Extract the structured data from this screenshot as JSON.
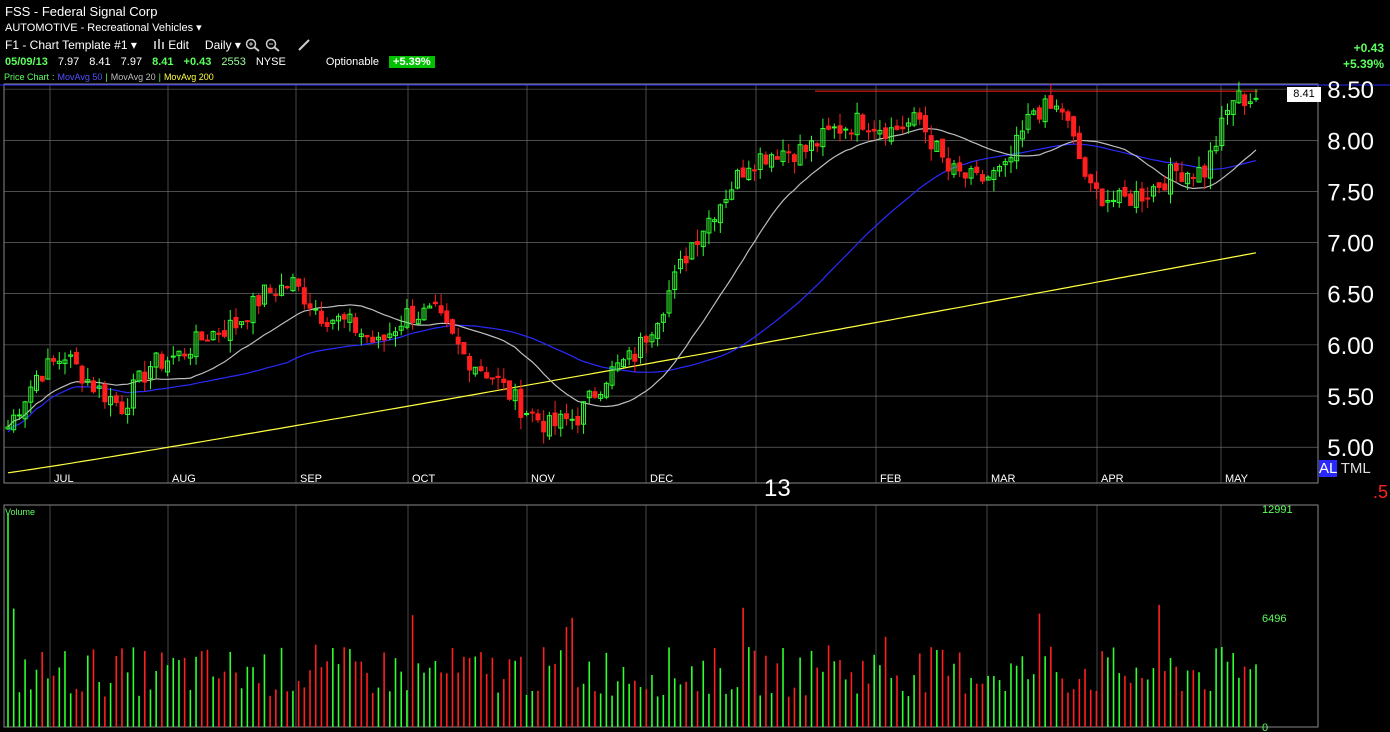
{
  "header": {
    "title": "FSS  -  Federal Signal Corp",
    "industry": "AUTOMOTIVE - Recreational Vehicles",
    "template": "F1 - Chart Template #1",
    "edit_label": "Edit",
    "period": "Daily",
    "optionable_label": "Optionable",
    "pct_badge": "+5.39%"
  },
  "quote": {
    "date": "05/09/13",
    "open": "7.97",
    "high": "8.41",
    "low": "7.97",
    "close": "8.41",
    "change": "+0.43",
    "volume": "2553",
    "exchange": "NYSE"
  },
  "right_change": {
    "change": "+0.43",
    "pct": "+5.39%"
  },
  "legend": {
    "price_chart": "Price Chart",
    "ma50": "MovAvg 50",
    "ma20": "MovAvg 20",
    "ma200": "MovAvg 200"
  },
  "colors": {
    "up": "#2fff2f",
    "down": "#ff1f1f",
    "ma20": "#bdbdbd",
    "ma50": "#2a2aff",
    "ma200": "#ffff40",
    "grid": "#7a7a7a",
    "bg": "#000000"
  },
  "price_label": "8.41",
  "year_label": "13",
  "al_tml": {
    "al": "AL",
    "tml": " TML",
    "sub": ".5"
  },
  "chart_data": [
    {
      "type": "candlestick",
      "title": "FSS",
      "x_months": [
        "JUL",
        "AUG",
        "SEP",
        "OCT",
        "NOV",
        "DEC",
        "13",
        "FEB",
        "MAR",
        "APR",
        "MAY"
      ],
      "y_ticks": [
        "5.00",
        "5.50",
        "6.00",
        "6.50",
        "7.00",
        "7.50",
        "8.00",
        "8.50"
      ],
      "ylim": [
        4.65,
        8.55
      ],
      "series_weekly_approx": {
        "close": [
          5.2,
          5.7,
          5.9,
          5.6,
          5.4,
          5.8,
          5.9,
          6.1,
          6.2,
          6.5,
          6.6,
          6.3,
          6.2,
          6.0,
          6.3,
          6.3,
          5.9,
          5.7,
          5.4,
          5.2,
          5.3,
          5.7,
          5.9,
          6.4,
          7.0,
          7.4,
          7.8,
          7.9,
          7.9,
          8.1,
          8.2,
          8.1,
          8.2,
          7.7,
          7.6,
          7.7,
          8.3,
          8.3,
          7.5,
          7.4,
          7.5,
          7.7,
          7.7,
          8.41
        ]
      },
      "moving_averages": [
        {
          "name": "MovAvg 20"
        },
        {
          "name": "MovAvg 50"
        },
        {
          "name": "MovAvg 200"
        }
      ],
      "last_price": 8.41,
      "grid": true
    },
    {
      "type": "bar",
      "title": "Volume",
      "y_ticks": [
        "0",
        "6496",
        "12991"
      ],
      "ylim": [
        0,
        12991
      ]
    }
  ],
  "volume_title": "Volume"
}
